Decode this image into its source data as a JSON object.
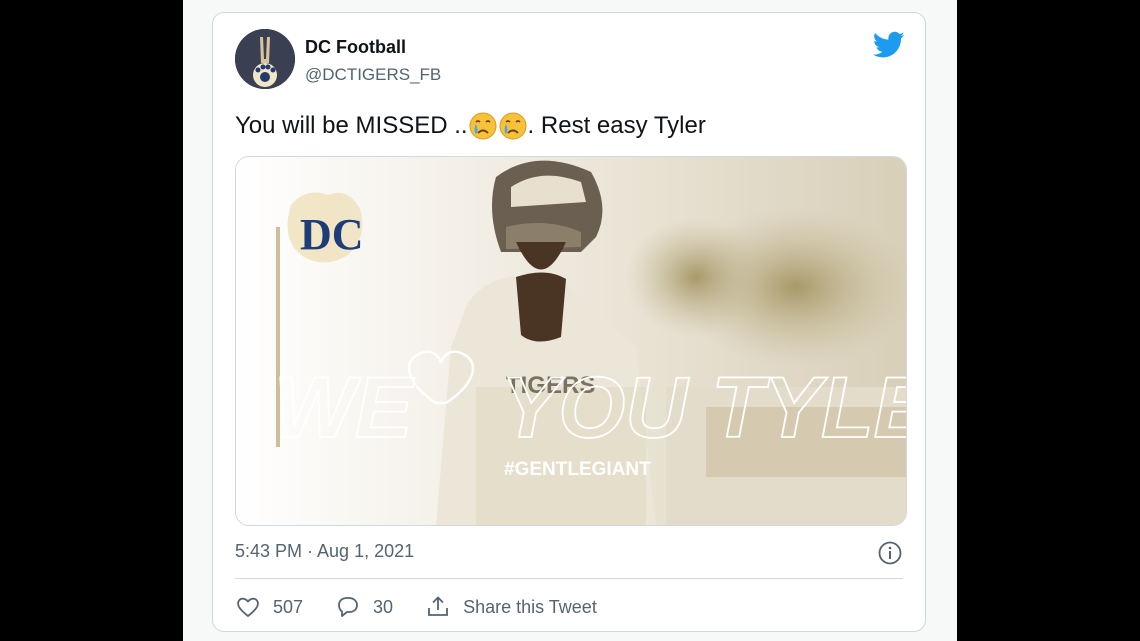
{
  "tweet": {
    "author_name": "DC Football",
    "author_handle": "@DCTIGERS_FB",
    "text_before": "You will be MISSED ..",
    "text_after": ". Rest easy Tyler",
    "timestamp": "5:43 PM · Aug 1, 2021",
    "likes": "507",
    "replies": "30",
    "share_label": "Share this Tweet"
  },
  "media": {
    "logo_text": "DC",
    "headline_left": "WE",
    "headline_right": "YOU TYLER",
    "hashtag": "#GENTLEGIANT",
    "jersey_text": "TIGERS"
  },
  "icons": {
    "brand": "twitter-bird-icon",
    "emoji": "crying-face-emoji",
    "info": "info-icon",
    "like": "heart-icon",
    "reply": "reply-icon",
    "share": "share-icon"
  },
  "colors": {
    "twitter_blue": "#1d9bf0",
    "text_primary": "#0f1419",
    "text_secondary": "#536471",
    "border": "#cfd9de"
  }
}
